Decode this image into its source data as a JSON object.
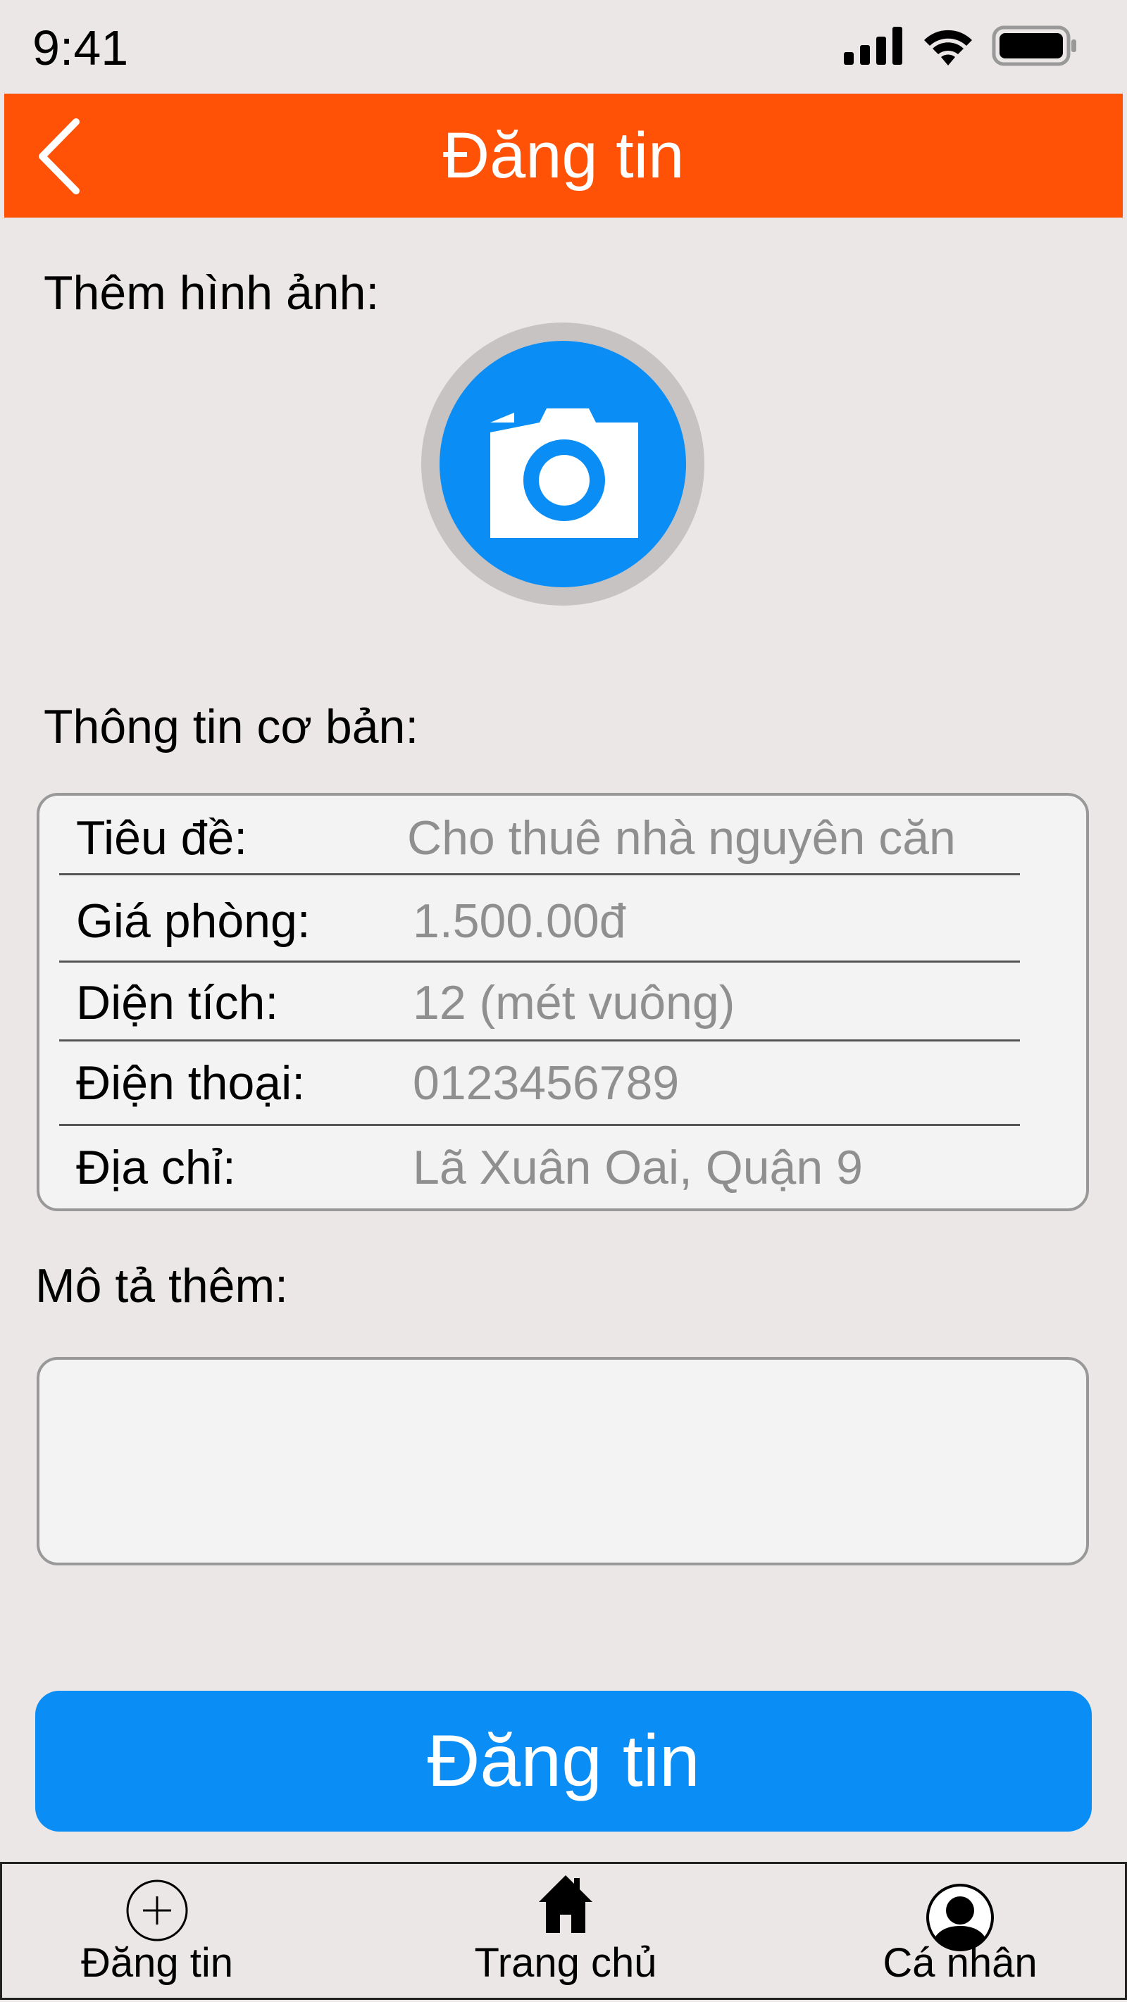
{
  "status_bar": {
    "time": "9:41"
  },
  "header": {
    "title": "Đăng tin"
  },
  "photo_section": {
    "label": "Thêm hình ảnh:"
  },
  "basic_info": {
    "label": "Thông tin cơ bản:",
    "fields": [
      {
        "key": "Tiêu đề:",
        "value": "Cho thuê nhà nguyên căn"
      },
      {
        "key": "Giá phòng:",
        "value": "1.500.00đ"
      },
      {
        "key": "Diện tích:",
        "value": "12 (mét vuông)"
      },
      {
        "key": "Điện thoại:",
        "value": "0123456789"
      },
      {
        "key": "Địa chỉ:",
        "value": "Lã Xuân Oai, Quận 9"
      }
    ]
  },
  "description": {
    "label": "Mô tả thêm:",
    "value": ""
  },
  "submit": {
    "label": "Đăng tin"
  },
  "tabbar": {
    "items": [
      {
        "label": "Đăng tin",
        "icon": "plus-circle-icon"
      },
      {
        "label": "Trang chủ",
        "icon": "home-icon"
      },
      {
        "label": "Cá nhân",
        "icon": "user-icon"
      }
    ]
  },
  "colors": {
    "header": "#ff5206",
    "primary": "#0a8ef6",
    "background": "#ece7e7"
  }
}
